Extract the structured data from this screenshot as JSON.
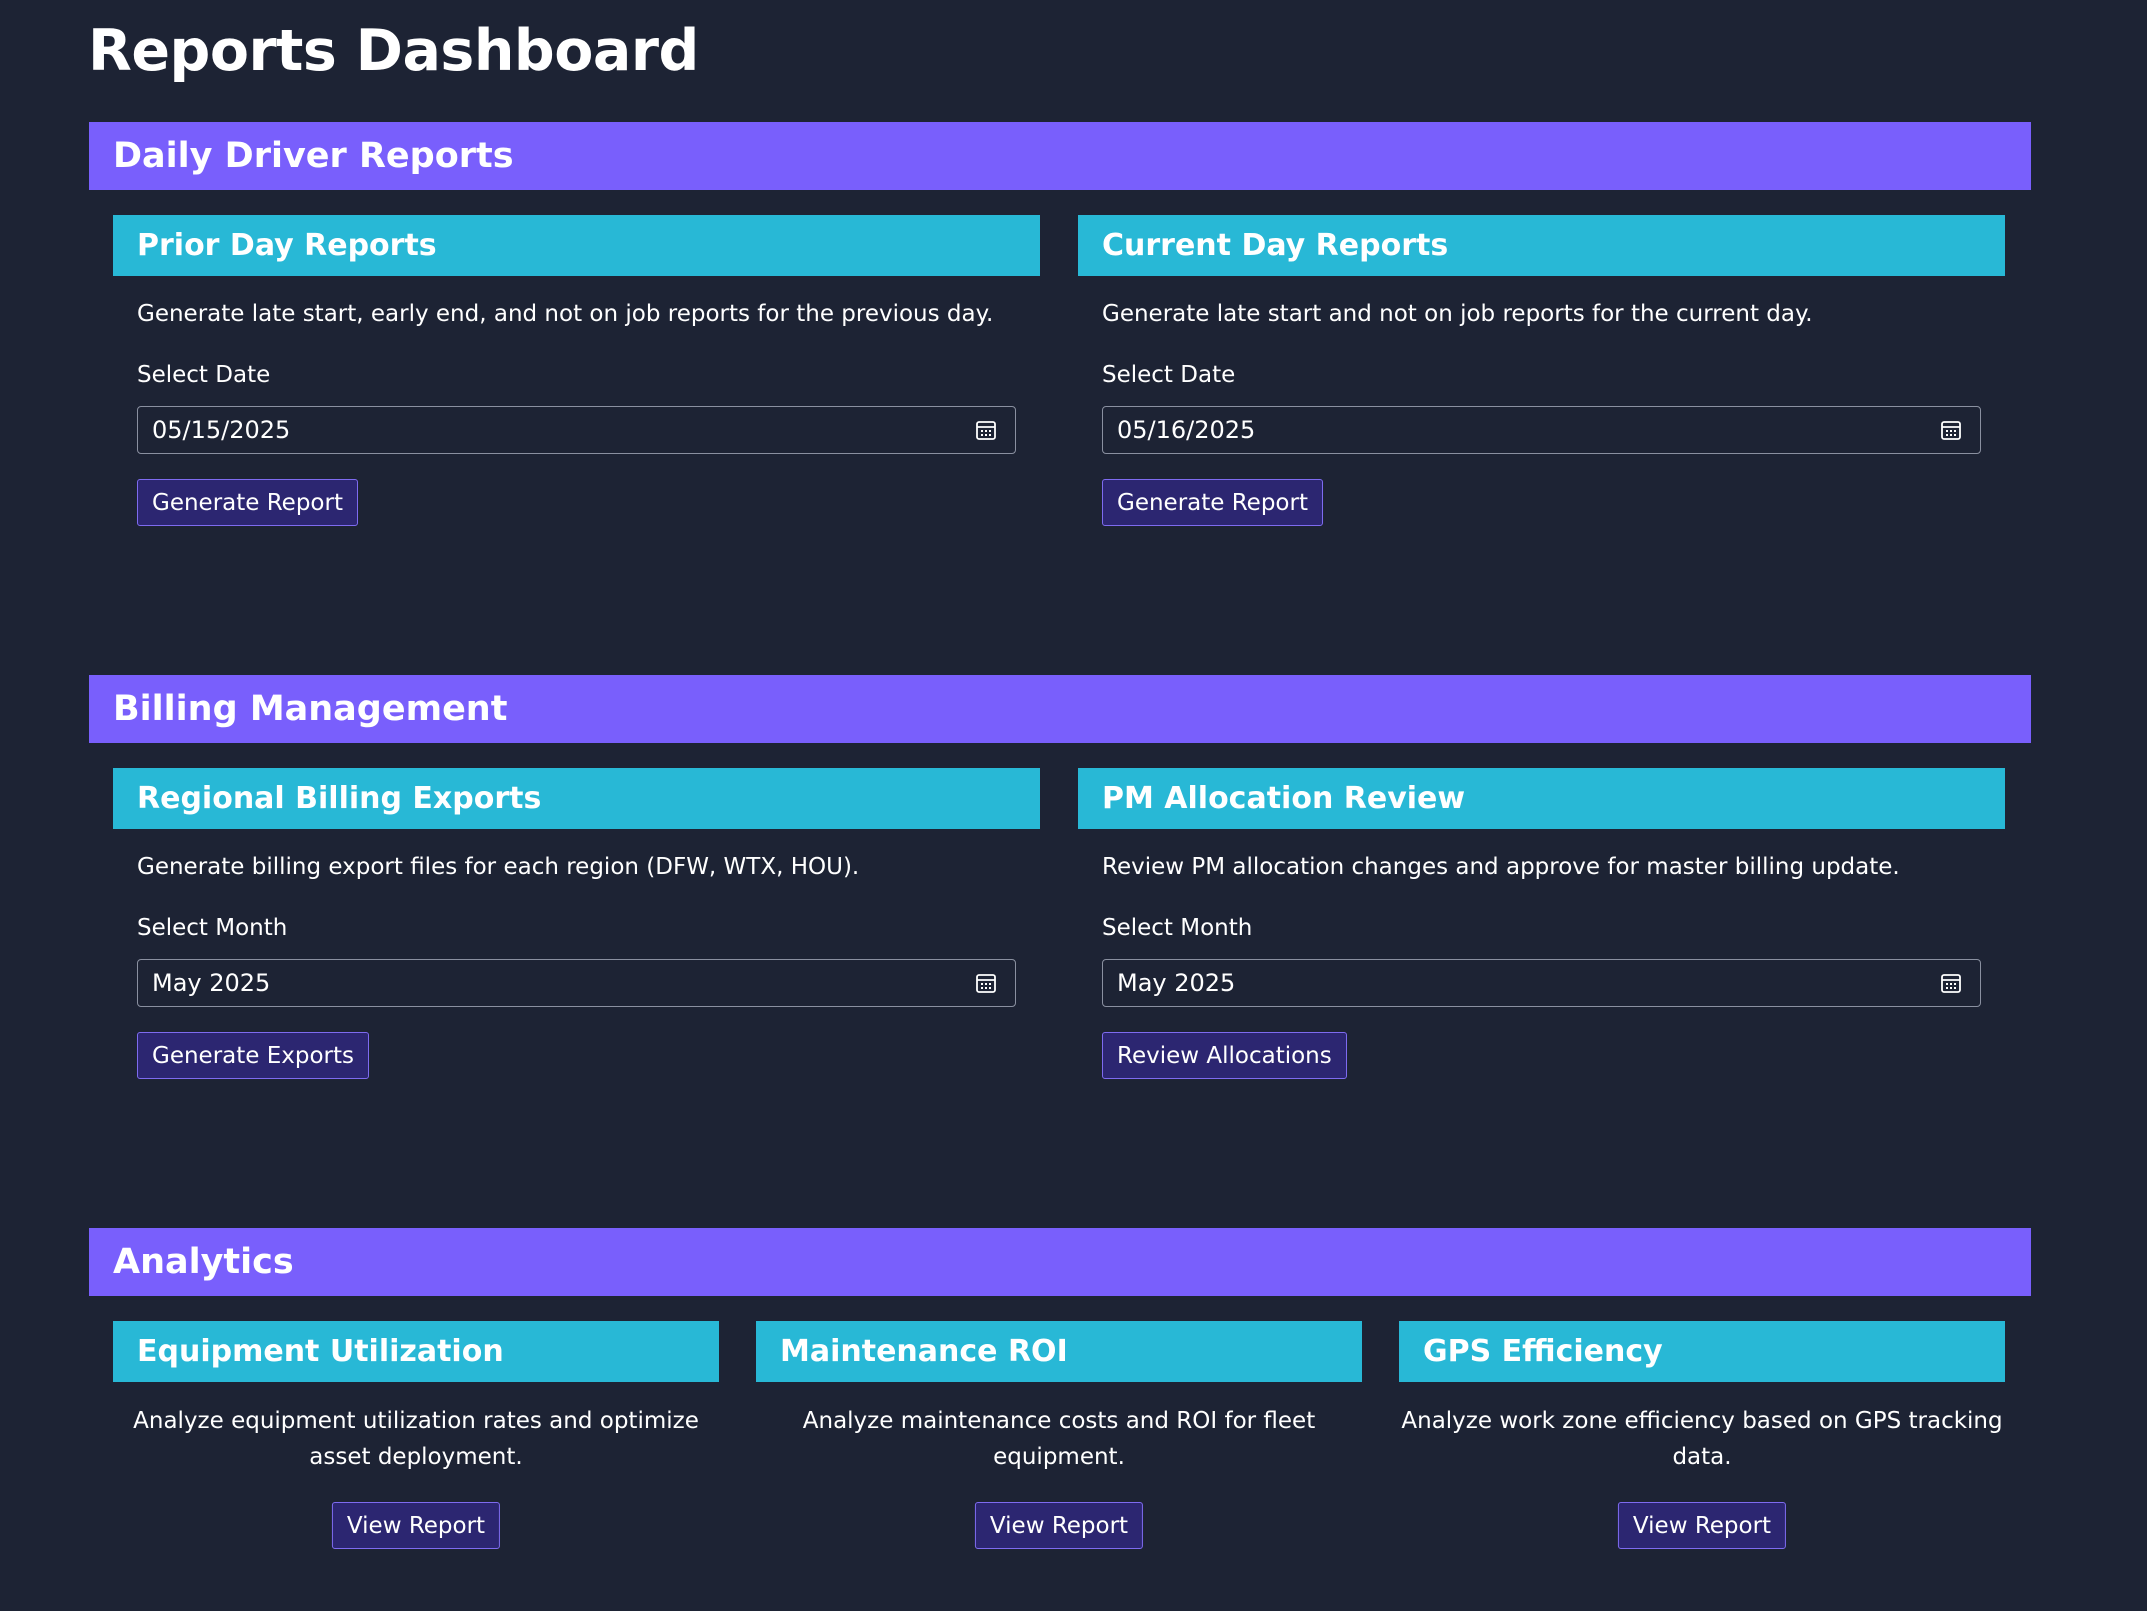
{
  "page": {
    "title": "Reports Dashboard"
  },
  "sections": {
    "daily": {
      "title": "Daily Driver Reports",
      "prior": {
        "title": "Prior Day Reports",
        "description": "Generate late start, early end, and not on job reports for the previous day.",
        "field_label": "Select Date",
        "value": "05/15/2025",
        "button": "Generate Report"
      },
      "current": {
        "title": "Current Day Reports",
        "description": "Generate late start and not on job reports for the current day.",
        "field_label": "Select Date",
        "value": "05/16/2025",
        "button": "Generate Report"
      }
    },
    "billing": {
      "title": "Billing Management",
      "regional": {
        "title": "Regional Billing Exports",
        "description": "Generate billing export files for each region (DFW, WTX, HOU).",
        "field_label": "Select Month",
        "value": "May 2025",
        "button": "Generate Exports"
      },
      "pm": {
        "title": "PM Allocation Review",
        "description": "Review PM allocation changes and approve for master billing update.",
        "field_label": "Select Month",
        "value": "May 2025",
        "button": "Review Allocations"
      }
    },
    "analytics": {
      "title": "Analytics",
      "equipment": {
        "title": "Equipment Utilization",
        "description": "Analyze equipment utilization rates and optimize asset deployment.",
        "button": "View Report"
      },
      "maintenance": {
        "title": "Maintenance ROI",
        "description": "Analyze maintenance costs and ROI for fleet equipment.",
        "button": "View Report"
      },
      "gps": {
        "title": "GPS Efficiency",
        "description": "Analyze work zone efficiency based on GPS tracking data.",
        "button": "View Report"
      }
    }
  },
  "icons": {
    "date_picker": "calendar-icon"
  },
  "colors": {
    "background": "#1d2334",
    "section_header": "#795ffc",
    "card_header": "#28b8d6",
    "button_bg": "#2c2671",
    "button_border": "#7e6bf0"
  }
}
